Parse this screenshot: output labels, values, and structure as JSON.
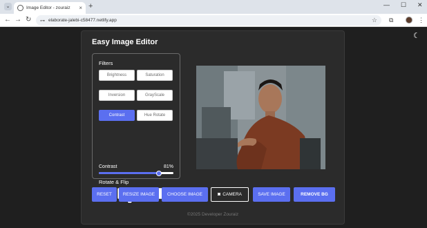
{
  "browser": {
    "tab_title": "Image Editor - zouraiz",
    "tab_close": "×",
    "new_tab": "+",
    "tab_list": "⌄",
    "url": "elaborate-jalebi-c58477.netlify.app",
    "win_min": "—",
    "win_max": "☐",
    "win_close": "✕"
  },
  "app": {
    "title": "Easy Image Editor",
    "filters_label": "Filters",
    "filters": [
      {
        "label": "Brightness"
      },
      {
        "label": "Saturation"
      },
      {
        "label": "Inversion"
      },
      {
        "label": "GrayScale"
      },
      {
        "label": "Contrast"
      },
      {
        "label": "Hue Rotate"
      }
    ],
    "active_filter": "Contrast",
    "slider": {
      "name": "Contrast",
      "value_text": "81%",
      "value": 0.81
    },
    "rotate_label": "Rotate & Flip",
    "rotate_buttons": [
      {
        "icon": "rotate-left-icon",
        "glyph": "↺"
      },
      {
        "icon": "rotate-right-icon",
        "glyph": "↻"
      },
      {
        "icon": "flip-horizontal-icon",
        "glyph": "⇹"
      },
      {
        "icon": "flip-vertical-icon",
        "glyph": "⇵"
      }
    ],
    "buttons": {
      "reset": "RESET",
      "resize": "RESIZE IMAGE",
      "choose": "CHOOSE IMAGE",
      "camera": "CAMERA",
      "save": "SAVE IMAGE",
      "remove_bg": "REMOVE BG"
    },
    "footer": "©2025 Developer Zouraiz"
  },
  "colors": {
    "accent": "#5b6ff0",
    "background": "#1f1f1f",
    "card": "#2b2b2b"
  }
}
